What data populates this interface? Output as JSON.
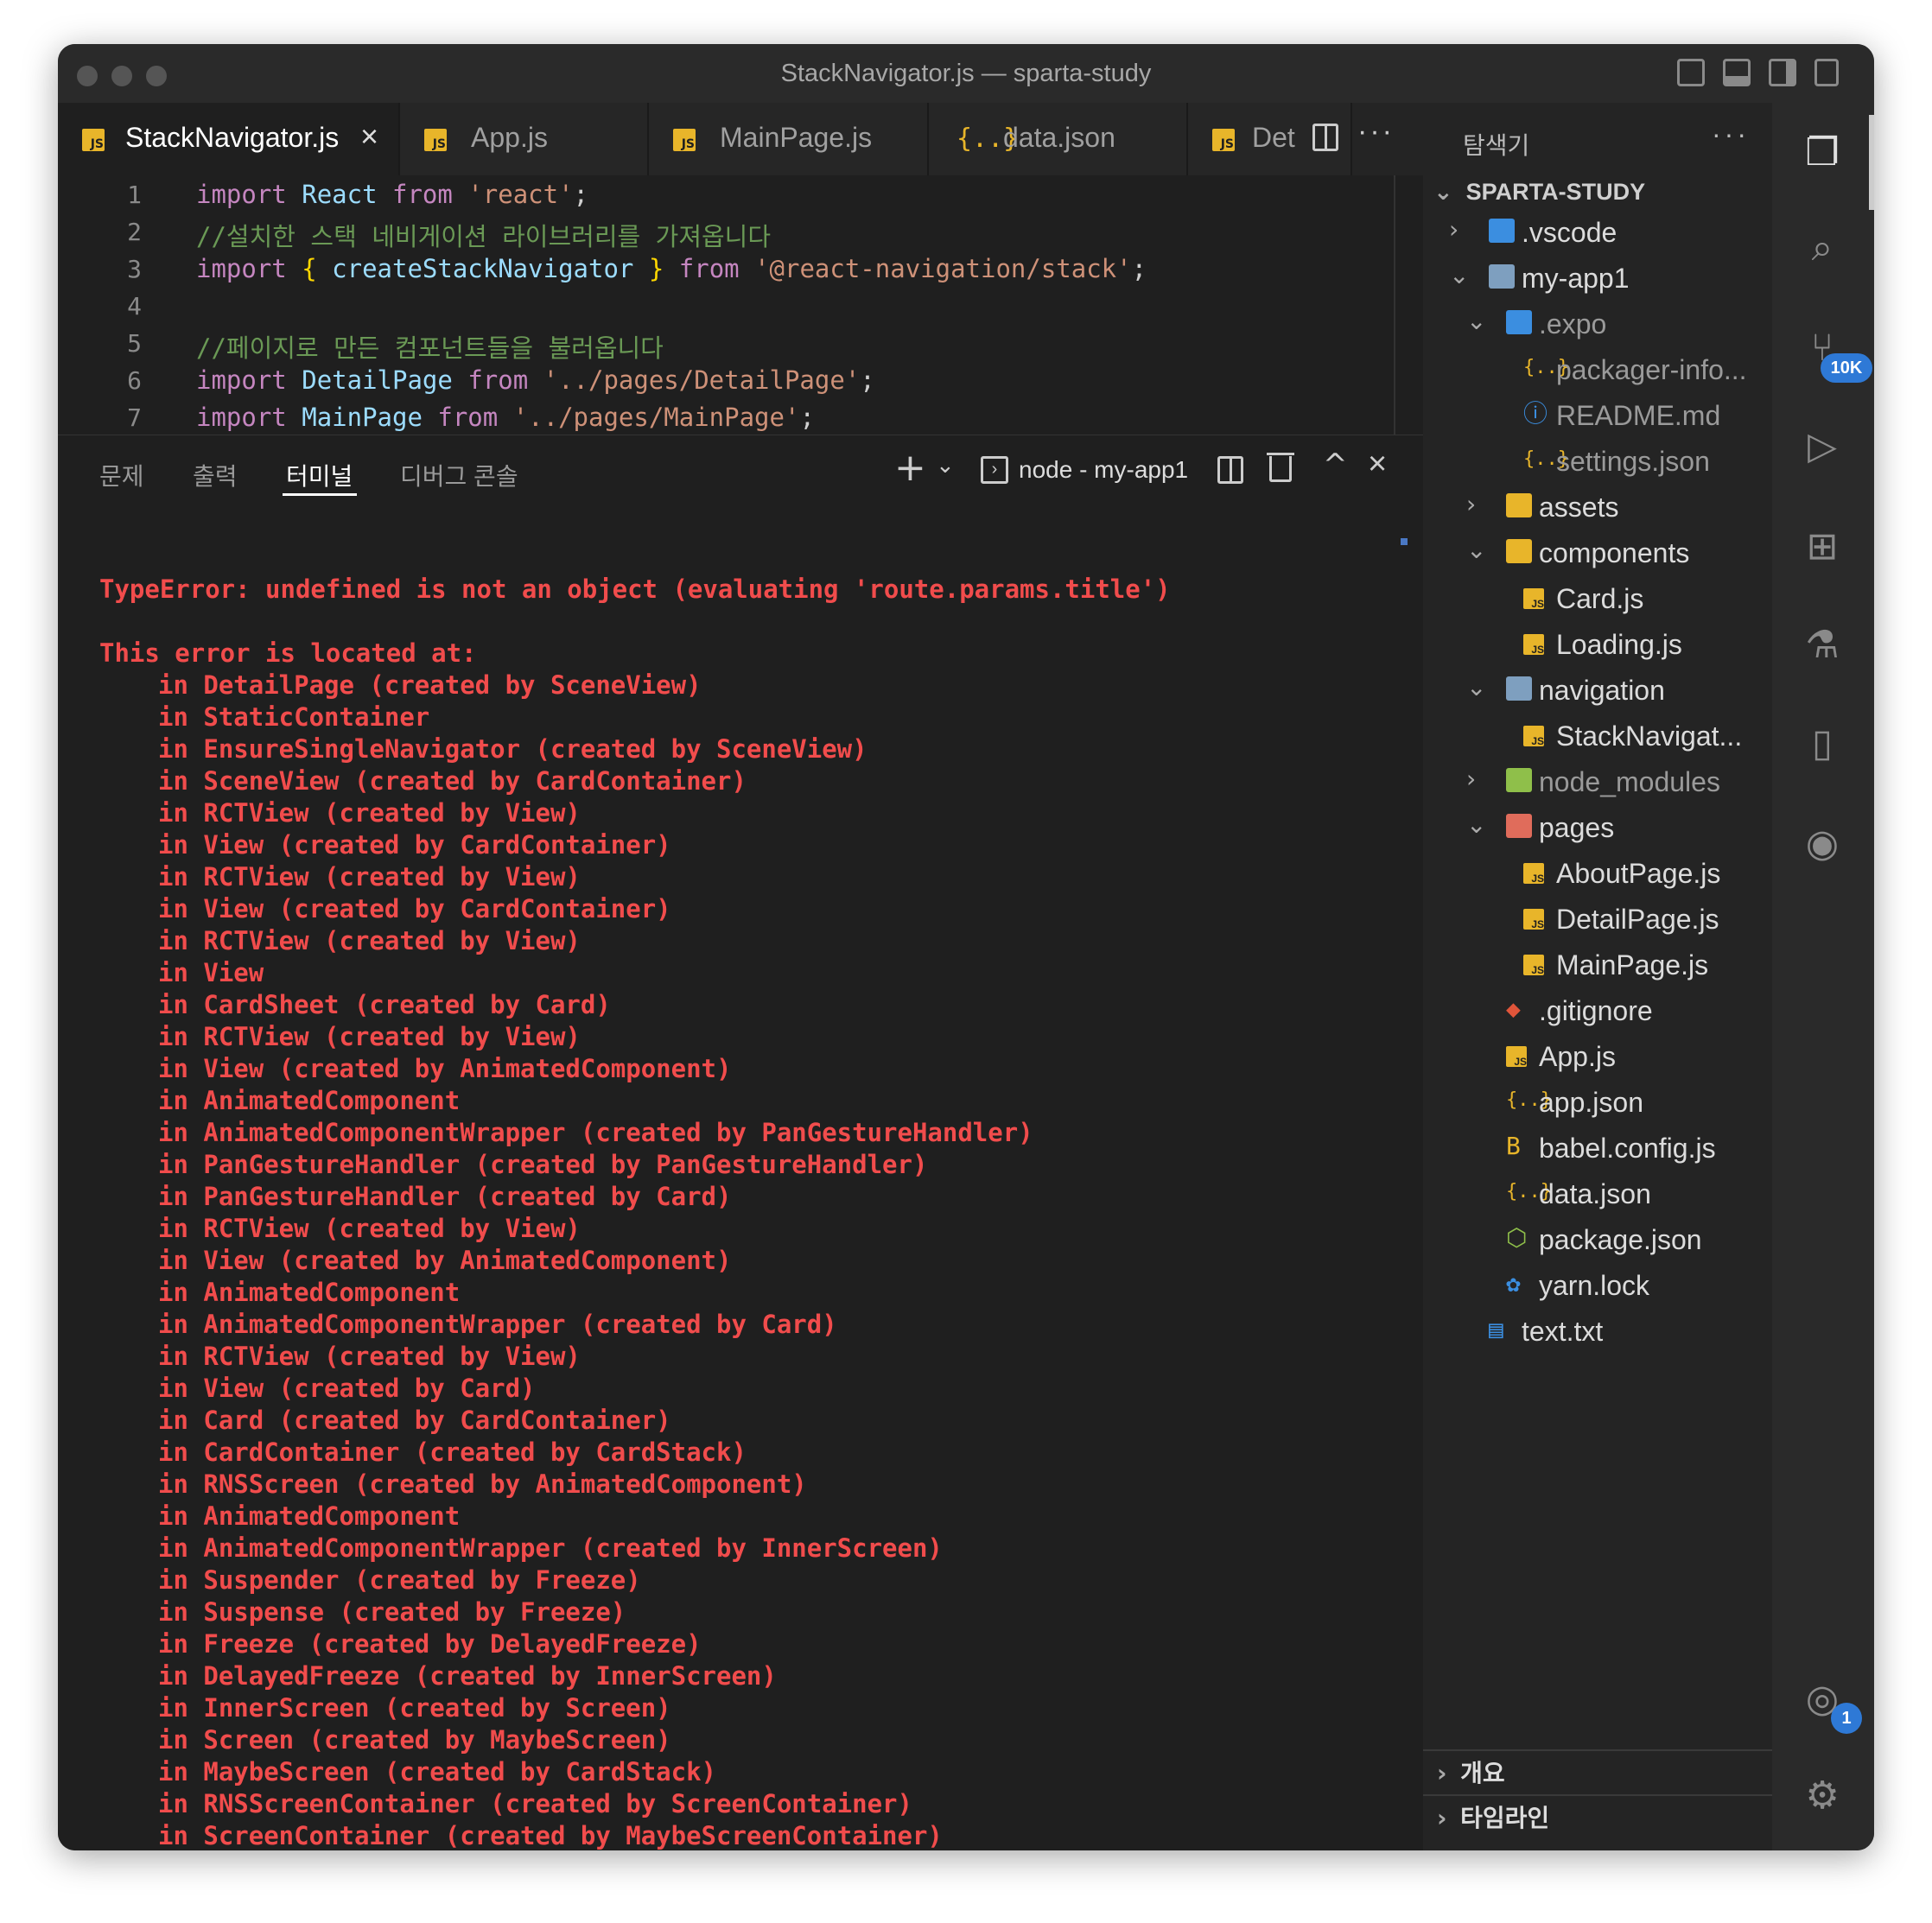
{
  "window": {
    "title": "StackNavigator.js — sparta-study"
  },
  "tabs": [
    {
      "label": "StackNavigator.js",
      "icon": "js-file-icon",
      "active": true
    },
    {
      "label": "App.js",
      "icon": "js-file-icon"
    },
    {
      "label": "MainPage.js",
      "icon": "js-file-icon"
    },
    {
      "label": "data.json",
      "icon": "json-file-icon"
    },
    {
      "label": "Det",
      "icon": "js-file-icon"
    }
  ],
  "editor": {
    "lines": [
      {
        "n": "1",
        "text": "import React from 'react';"
      },
      {
        "n": "2",
        "text": "//설치한 스택 네비게이션 라이브러리를 가져옵니다"
      },
      {
        "n": "3",
        "text": "import { createStackNavigator } from '@react-navigation/stack';"
      },
      {
        "n": "4",
        "text": ""
      },
      {
        "n": "5",
        "text": "//페이지로 만든 컴포넌트들을 불러옵니다"
      },
      {
        "n": "6",
        "text": "import DetailPage from '../pages/DetailPage';"
      },
      {
        "n": "7",
        "text": "import MainPage from '../pages/MainPage';"
      }
    ]
  },
  "panel": {
    "tabs": [
      "문제",
      "출력",
      "터미널",
      "디버그 콘솔"
    ],
    "active_tab": "터미널",
    "terminal_name": "node - my-app1"
  },
  "terminal": {
    "error": "TypeError: undefined is not an object (evaluating 'route.params.title')",
    "located": "This error is located at:",
    "stack": [
      "in DetailPage (created by SceneView)",
      "in StaticContainer",
      "in EnsureSingleNavigator (created by SceneView)",
      "in SceneView (created by CardContainer)",
      "in RCTView (created by View)",
      "in View (created by CardContainer)",
      "in RCTView (created by View)",
      "in View (created by CardContainer)",
      "in RCTView (created by View)",
      "in View",
      "in CardSheet (created by Card)",
      "in RCTView (created by View)",
      "in View (created by AnimatedComponent)",
      "in AnimatedComponent",
      "in AnimatedComponentWrapper (created by PanGestureHandler)",
      "in PanGestureHandler (created by PanGestureHandler)",
      "in PanGestureHandler (created by Card)",
      "in RCTView (created by View)",
      "in View (created by AnimatedComponent)",
      "in AnimatedComponent",
      "in AnimatedComponentWrapper (created by Card)",
      "in RCTView (created by View)",
      "in View (created by Card)",
      "in Card (created by CardContainer)",
      "in CardContainer (created by CardStack)",
      "in RNSScreen (created by AnimatedComponent)",
      "in AnimatedComponent",
      "in AnimatedComponentWrapper (created by InnerScreen)",
      "in Suspender (created by Freeze)",
      "in Suspense (created by Freeze)",
      "in Freeze (created by DelayedFreeze)",
      "in DelayedFreeze (created by InnerScreen)",
      "in InnerScreen (created by Screen)",
      "in Screen (created by MaybeScreen)",
      "in MaybeScreen (created by CardStack)",
      "in RNSScreenContainer (created by ScreenContainer)",
      "in ScreenContainer (created by MaybeScreenContainer)"
    ]
  },
  "explorer": {
    "title": "탐색기",
    "root": "SPARTA-STUDY",
    "items": [
      {
        "label": ".vscode",
        "depth": 1,
        "chevron": "›",
        "icon": "vscode-folder-icon"
      },
      {
        "label": "my-app1",
        "depth": 1,
        "chevron": "⌄",
        "icon": "folder-open-icon"
      },
      {
        "label": ".expo",
        "depth": 2,
        "chevron": "⌄",
        "icon": "expo-folder-icon",
        "dim": true
      },
      {
        "label": "packager-info...",
        "depth": 3,
        "chevron": "",
        "icon": "json-file-icon",
        "dim": true
      },
      {
        "label": "README.md",
        "depth": 3,
        "chevron": "",
        "icon": "info-icon",
        "dim": true
      },
      {
        "label": "settings.json",
        "depth": 3,
        "chevron": "",
        "icon": "json-file-icon",
        "dim": true
      },
      {
        "label": "assets",
        "depth": 2,
        "chevron": "›",
        "icon": "assets-folder-icon"
      },
      {
        "label": "components",
        "depth": 2,
        "chevron": "⌄",
        "icon": "components-folder-icon"
      },
      {
        "label": "Card.js",
        "depth": 3,
        "chevron": "",
        "icon": "js-file-icon"
      },
      {
        "label": "Loading.js",
        "depth": 3,
        "chevron": "",
        "icon": "js-file-icon"
      },
      {
        "label": "navigation",
        "depth": 2,
        "chevron": "⌄",
        "icon": "folder-open-icon"
      },
      {
        "label": "StackNavigat...",
        "depth": 3,
        "chevron": "",
        "icon": "js-file-icon"
      },
      {
        "label": "node_modules",
        "depth": 2,
        "chevron": "›",
        "icon": "node-folder-icon",
        "dim": true
      },
      {
        "label": "pages",
        "depth": 2,
        "chevron": "⌄",
        "icon": "pages-folder-icon"
      },
      {
        "label": "AboutPage.js",
        "depth": 3,
        "chevron": "",
        "icon": "js-file-icon"
      },
      {
        "label": "DetailPage.js",
        "depth": 3,
        "chevron": "",
        "icon": "js-file-icon"
      },
      {
        "label": "MainPage.js",
        "depth": 3,
        "chevron": "",
        "icon": "js-file-icon"
      },
      {
        "label": ".gitignore",
        "depth": 2,
        "chevron": "",
        "icon": "git-icon"
      },
      {
        "label": "App.js",
        "depth": 2,
        "chevron": "",
        "icon": "js-file-icon"
      },
      {
        "label": "app.json",
        "depth": 2,
        "chevron": "",
        "icon": "json-file-icon"
      },
      {
        "label": "babel.config.js",
        "depth": 2,
        "chevron": "",
        "icon": "babel-icon"
      },
      {
        "label": "data.json",
        "depth": 2,
        "chevron": "",
        "icon": "json-file-icon"
      },
      {
        "label": "package.json",
        "depth": 2,
        "chevron": "",
        "icon": "node-file-icon"
      },
      {
        "label": "yarn.lock",
        "depth": 2,
        "chevron": "",
        "icon": "yarn-icon"
      },
      {
        "label": "text.txt",
        "depth": 1,
        "chevron": "",
        "icon": "text-file-icon"
      }
    ],
    "outline": "개요",
    "timeline": "타임라인"
  },
  "activity": {
    "scm_badge": "10K",
    "accounts_badge": "1"
  }
}
